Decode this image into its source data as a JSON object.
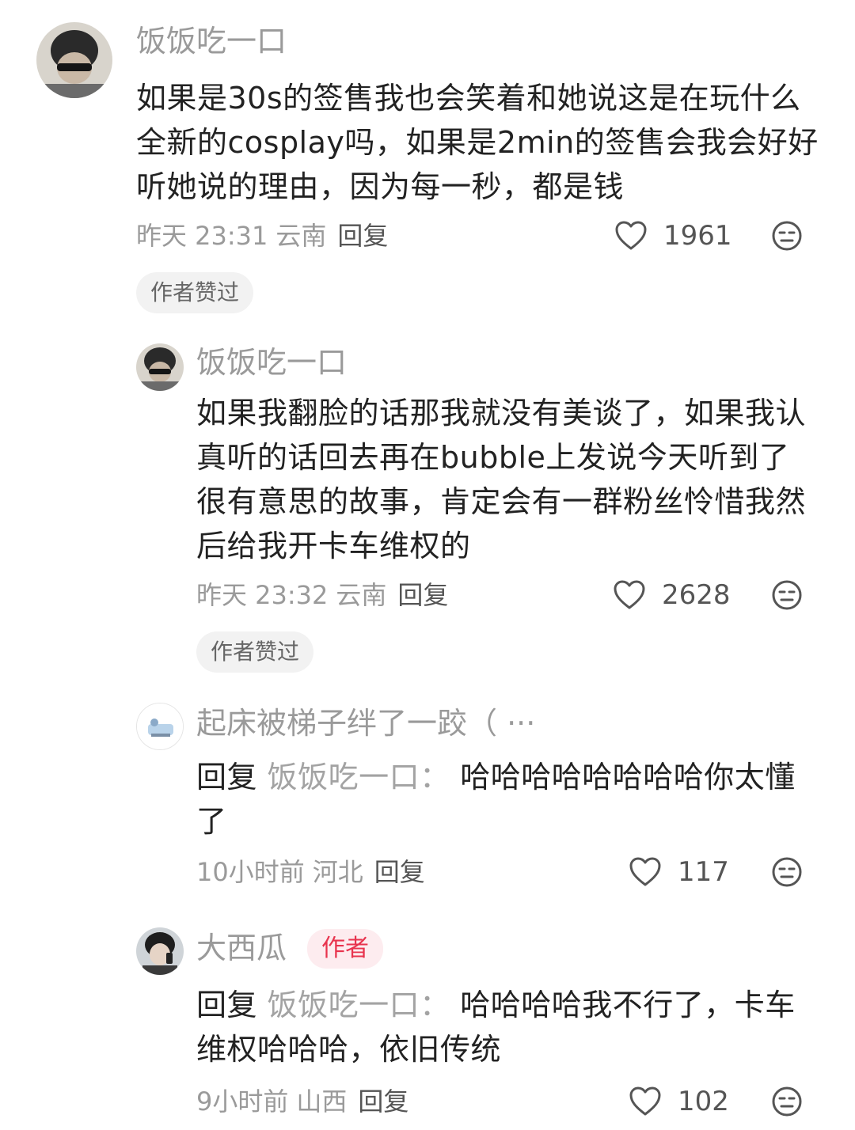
{
  "comments": [
    {
      "username": "饭饭吃一口",
      "text": "如果是30s的签售我也会笑着和她说这是在玩什么全新的cosplay吗，如果是2min的签售会我会好好听她说的理由，因为每一秒，都是钱",
      "time": "昨天 23:31",
      "location": "云南",
      "reply_label": "回复",
      "likes": "1961",
      "chip": "作者赞过"
    },
    {
      "username": "饭饭吃一口",
      "text": "如果我翻脸的话那我就没有美谈了，如果我认真听的话回去再在bubble上发说今天听到了很有意思的故事，肯定会有一群粉丝怜惜我然后给我开卡车维权的",
      "time": "昨天 23:32",
      "location": "云南",
      "reply_label": "回复",
      "likes": "2628",
      "chip": "作者赞过"
    },
    {
      "username": "起床被梯子绊了一跤（ ···",
      "reply_prefix": "回复",
      "reply_target": "饭饭吃一口：",
      "text": "哈哈哈哈哈哈哈哈你太懂了",
      "time": "10小时前",
      "location": "河北",
      "reply_label": "回复",
      "likes": "117"
    },
    {
      "username": "大西瓜",
      "badge": "作者",
      "reply_prefix": "回复",
      "reply_target": "饭饭吃一口：",
      "text": "哈哈哈哈我不行了，卡车维权哈哈哈，依旧传统",
      "time": "9小时前",
      "location": "山西",
      "reply_label": "回复",
      "likes": "102"
    }
  ],
  "icons": {
    "like": "heart-outline-icon",
    "dislike": "meh-face-icon"
  },
  "colors": {
    "username": "#9a9a9a",
    "text": "#222222",
    "author_badge_text": "#e8344e",
    "author_badge_bg": "#fdecef",
    "chip_bg": "#f2f2f2"
  }
}
